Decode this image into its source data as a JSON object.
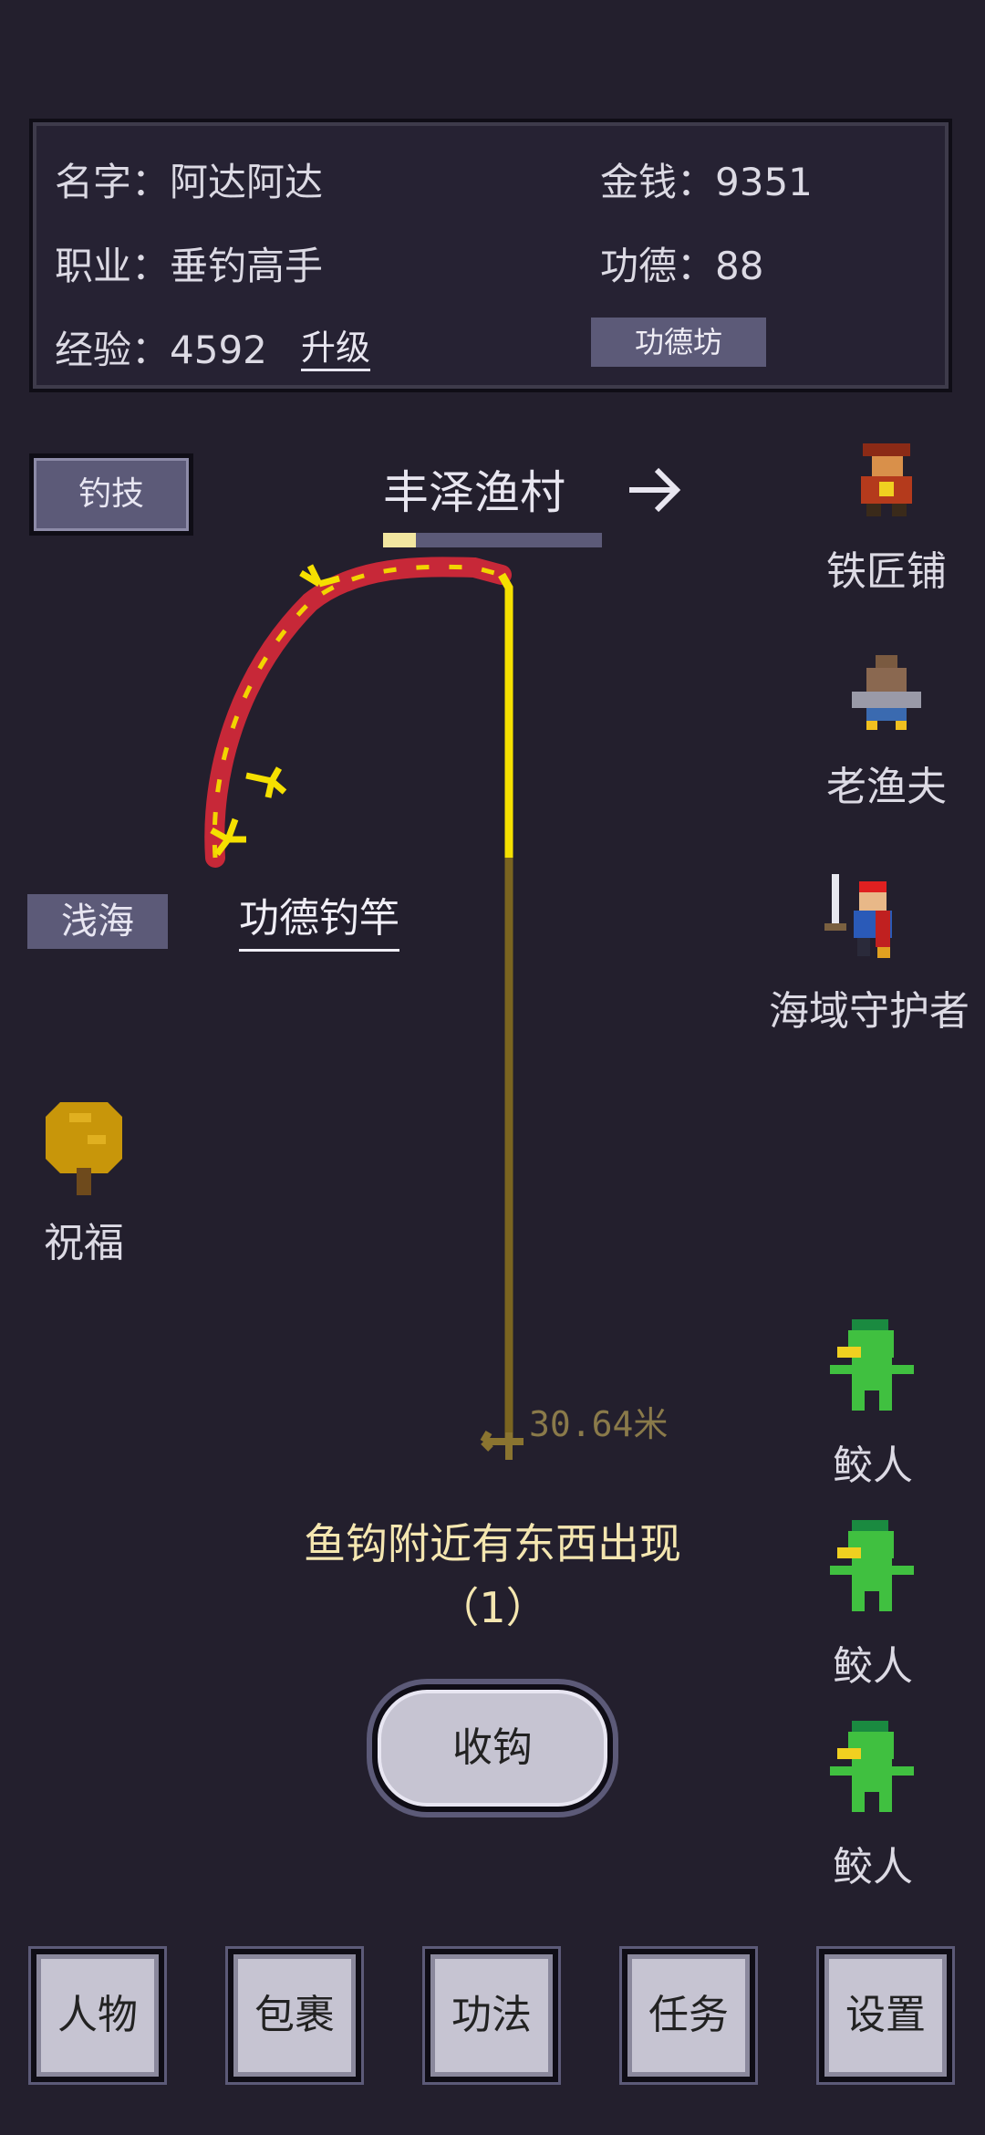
{
  "player": {
    "name_label": "名字：",
    "name": "阿达阿达",
    "job_label": "职业：",
    "job": "垂钓高手",
    "exp_label": "经验：",
    "exp": "4592",
    "upgrade": "升级",
    "money_label": "金钱：",
    "money": "9351",
    "merit_label": "功德：",
    "merit": "88",
    "merit_shop": "功德坊"
  },
  "skills_button": "钓技",
  "location": {
    "name": "丰泽渔村",
    "progress": 0.15
  },
  "fishing_spot": "浅海",
  "rod_name": "功德钓竿",
  "blessing": "祝福",
  "depth": "30.64米",
  "message": {
    "line1": "鱼钩附近有东西出现",
    "line2": "（1）"
  },
  "reel_button": "收钩",
  "npcs": [
    {
      "label": "铁匠铺",
      "icon": "blacksmith-icon"
    },
    {
      "label": "老渔夫",
      "icon": "old-fisherman-icon"
    },
    {
      "label": "海域守护者",
      "icon": "sea-guardian-icon"
    }
  ],
  "monsters": [
    {
      "label": "鲛人",
      "icon": "merfolk-icon"
    },
    {
      "label": "鲛人",
      "icon": "merfolk-icon"
    },
    {
      "label": "鲛人",
      "icon": "merfolk-icon"
    }
  ],
  "nav": [
    "人物",
    "包裹",
    "功法",
    "任务",
    "设置"
  ],
  "colors": {
    "background": "#231f2d",
    "button": "#5c5a78",
    "line_gold": "#f5e000",
    "line_brown": "#7a6420",
    "message": "#f4e6b0"
  }
}
